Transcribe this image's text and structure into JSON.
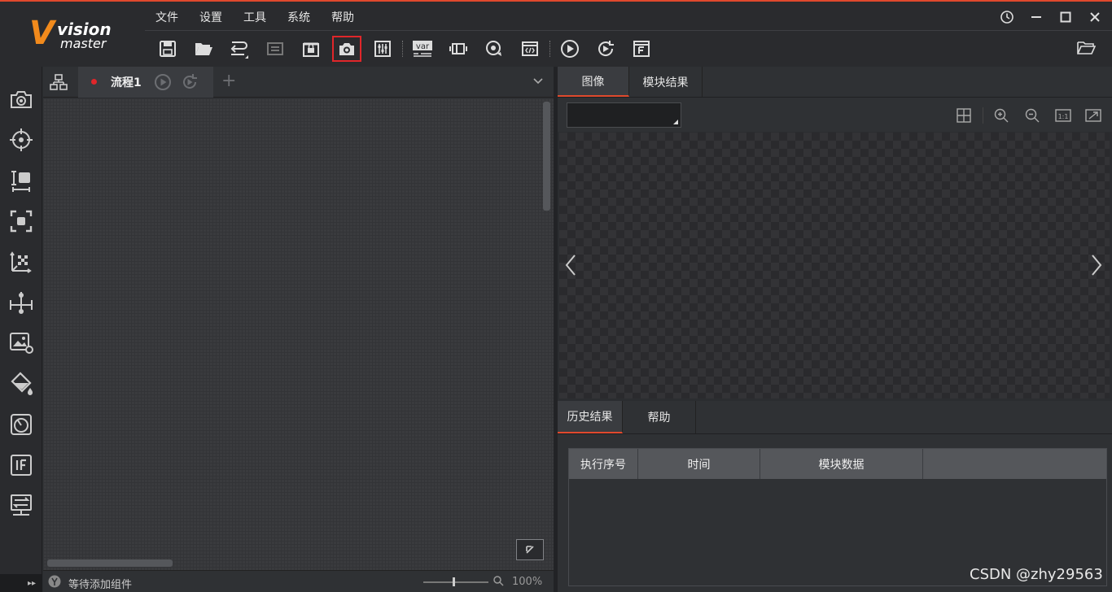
{
  "app": {
    "logo_v": "V",
    "logo_line1": "vision",
    "logo_line2": "master",
    "accent_color": "#e0492d"
  },
  "menu": [
    "文件",
    "设置",
    "工具",
    "系统",
    "帮助"
  ],
  "window_controls": [
    "history-icon",
    "minimize-icon",
    "maximize-icon",
    "close-icon"
  ],
  "toolbar": {
    "buttons": [
      "save-icon",
      "open-icon",
      "undo-icon",
      "redo-icon",
      "lock-icon",
      "camera-icon",
      "adjust-icon",
      "variable-icon",
      "io-icon",
      "cycle-icon",
      "script-icon",
      "run-once-icon",
      "run-loop-icon",
      "format-icon"
    ],
    "selected": "camera-icon",
    "var_label": "var"
  },
  "sidebar": [
    "camera-icon",
    "locate-icon",
    "measure-icon",
    "recognize-icon",
    "calibrate-icon",
    "align-icon",
    "image-process-icon",
    "color-icon",
    "defect-icon",
    "logic-icon",
    "communication-icon"
  ],
  "flow": {
    "tab_label": "流程1",
    "add_label": "+",
    "status_text": "等待添加组件",
    "zoom": "100%"
  },
  "image_panel": {
    "tabs": [
      "图像",
      "模块结果"
    ],
    "active_tab": "图像"
  },
  "history_panel": {
    "tabs": [
      "历史结果",
      "帮助"
    ],
    "active_tab": "历史结果",
    "columns": [
      "执行序号",
      "时间",
      "模块数据",
      ""
    ]
  },
  "watermark": "CSDN @zhy29563"
}
